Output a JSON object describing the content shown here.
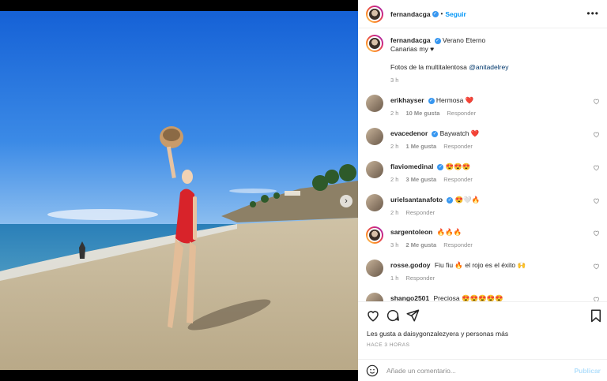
{
  "post": {
    "author": "fernandacga",
    "follow_label": "Seguir",
    "separator": "•",
    "carousel_dots": 3,
    "active_dot": 0
  },
  "caption": {
    "username": "fernandacga",
    "text": "Verano Eterno",
    "line2": "Canarias my ♥",
    "line3_prefix": "Fotos de la multitalentosa",
    "mention": "@anitadelrey",
    "time": "3 h"
  },
  "comments": [
    {
      "username": "erikhayser",
      "text": "Hermosa ❤️",
      "time": "2 h",
      "likes": "10 Me gusta",
      "reply": "Responder"
    },
    {
      "username": "evacedenor",
      "text": "Baywatch ❤️",
      "time": "2 h",
      "likes": "1 Me gusta",
      "reply": "Responder"
    },
    {
      "username": "flaviomedinal",
      "text": "😍😍😍",
      "time": "2 h",
      "likes": "3 Me gusta",
      "reply": "Responder"
    },
    {
      "username": "urielsantanafoto",
      "text": "😍🤍🔥",
      "time": "2 h",
      "likes": "",
      "reply": "Responder"
    },
    {
      "username": "sargentoleon",
      "text": "🔥🔥🔥",
      "time": "3 h",
      "likes": "2 Me gusta",
      "reply": "Responder"
    },
    {
      "username": "rosse.godoy",
      "text": "Fiu fiu 🔥 el rojo es el éxito 🙌",
      "time": "1 h",
      "likes": "",
      "reply": "Responder"
    },
    {
      "username": "shango2501",
      "text": "Preciosa 😍😍😍😍😍",
      "time": "",
      "likes": "",
      "reply": ""
    }
  ],
  "likes_text": "Les gusta a daisygonzalezyera y personas más",
  "time_ago": "HACE 3 HORAS",
  "add_comment": {
    "placeholder": "Añade un comentario...",
    "publish": "Publicar"
  },
  "colors": {
    "accent": "#0095f6",
    "heart": "#ed4956",
    "verified": "#3897f0"
  },
  "icons": [
    "heart-icon",
    "comment-icon",
    "share-icon",
    "bookmark-icon",
    "emoji-icon",
    "more-icon",
    "verified-icon",
    "chevron-right-icon"
  ]
}
